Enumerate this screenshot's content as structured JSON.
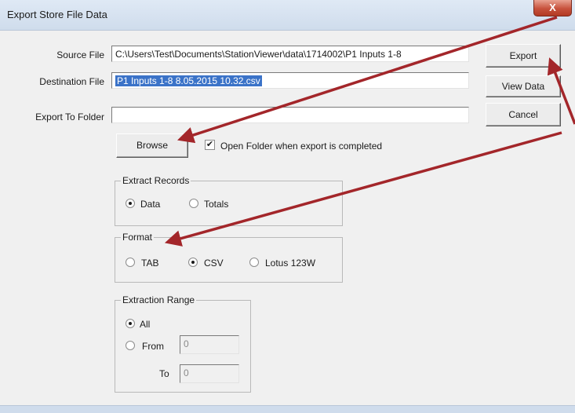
{
  "window": {
    "title": "Export Store File Data",
    "close_label": "X"
  },
  "form": {
    "source_label": "Source File",
    "source_value": "C:\\Users\\Test\\Documents\\StationViewer\\data\\1714002\\P1 Inputs 1-8",
    "destination_label": "Destination File",
    "destination_value": "P1 Inputs 1-8 8.05.2015 10.32.csv",
    "folder_label": "Export To Folder",
    "folder_value": "",
    "browse_label": "Browse",
    "open_folder_label": "Open Folder when export is completed",
    "open_folder_checked": true
  },
  "buttons": {
    "export": "Export",
    "view_data": "View Data",
    "cancel": "Cancel"
  },
  "extract_records": {
    "title": "Extract Records",
    "options": [
      {
        "label": "Data",
        "selected": true
      },
      {
        "label": "Totals",
        "selected": false
      }
    ]
  },
  "format": {
    "title": "Format",
    "options": [
      {
        "label": "TAB",
        "selected": false
      },
      {
        "label": "CSV",
        "selected": true
      },
      {
        "label": "Lotus 123W",
        "selected": false
      }
    ]
  },
  "extraction_range": {
    "title": "Extraction Range",
    "all_label": "All",
    "from_label": "From",
    "to_label": "To",
    "from_value": "0",
    "to_value": "0",
    "selected": "All"
  },
  "colors": {
    "annotation_arrow": "#a3262a",
    "selection": "#3b73c8"
  }
}
